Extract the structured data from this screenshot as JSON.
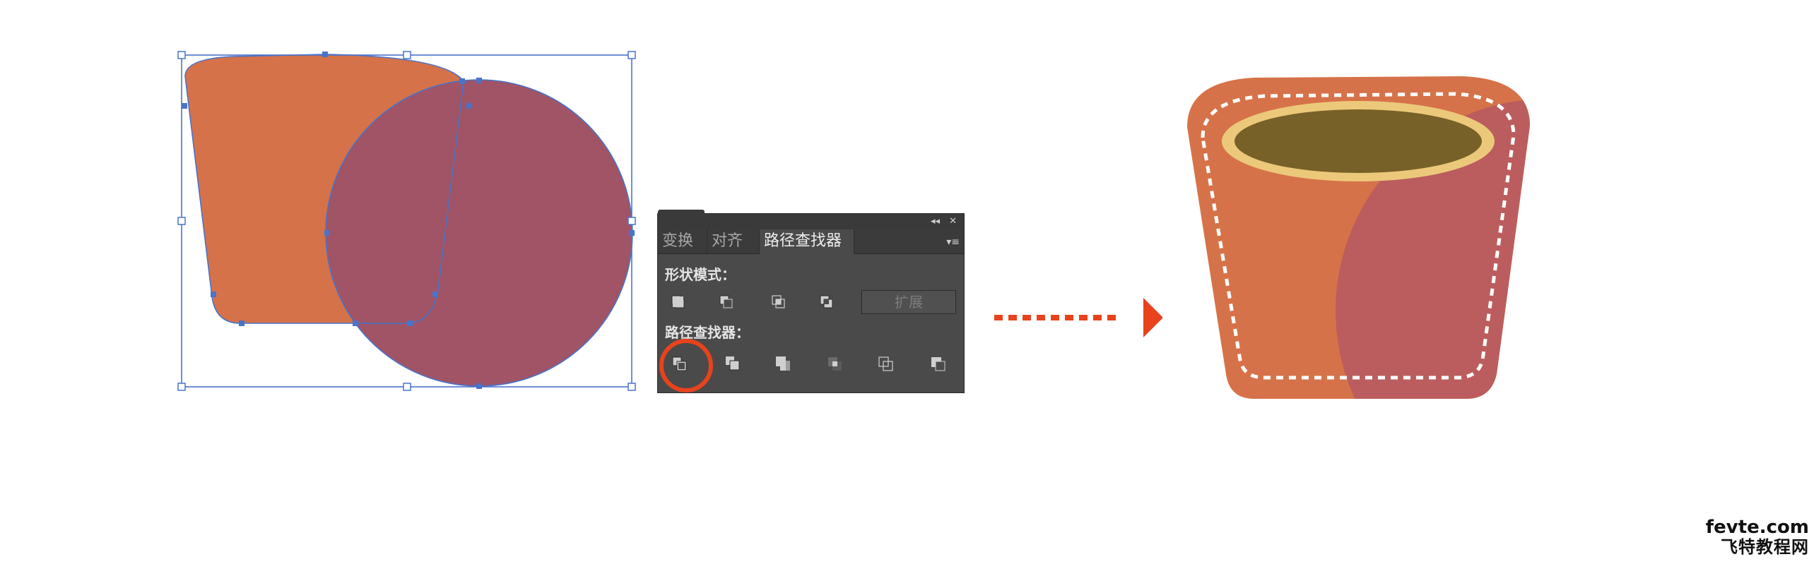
{
  "panel": {
    "tabs": [
      {
        "label": "变换",
        "active": false
      },
      {
        "label": "对齐",
        "active": false
      },
      {
        "label": "路径查找器",
        "active": true
      }
    ],
    "collapse_glyph": "◂◂",
    "close_glyph": "✕",
    "menu_glyph": "▾≡",
    "shape_modes_label": "形状模式：",
    "expand_label": "扩展",
    "pathfinders_label": "路径查找器：",
    "shape_mode_buttons": [
      "unite-icon",
      "minus-front-icon",
      "intersect-icon",
      "exclude-icon"
    ],
    "pathfinder_buttons": [
      "divide-icon",
      "trim-icon",
      "merge-icon",
      "crop-icon",
      "outline-icon",
      "minus-back-icon"
    ]
  },
  "colors": {
    "shape_orange": "#d67249",
    "shape_purple": "#a05466",
    "selection_blue": "#4a73c9",
    "highlight_red": "#e8431d",
    "cup_rim": "#ecc97a",
    "cup_inside": "#786128",
    "cup_shadow": "#bb5d5e"
  },
  "watermark": {
    "site": "fevte.com",
    "name": "飞特教程网"
  }
}
